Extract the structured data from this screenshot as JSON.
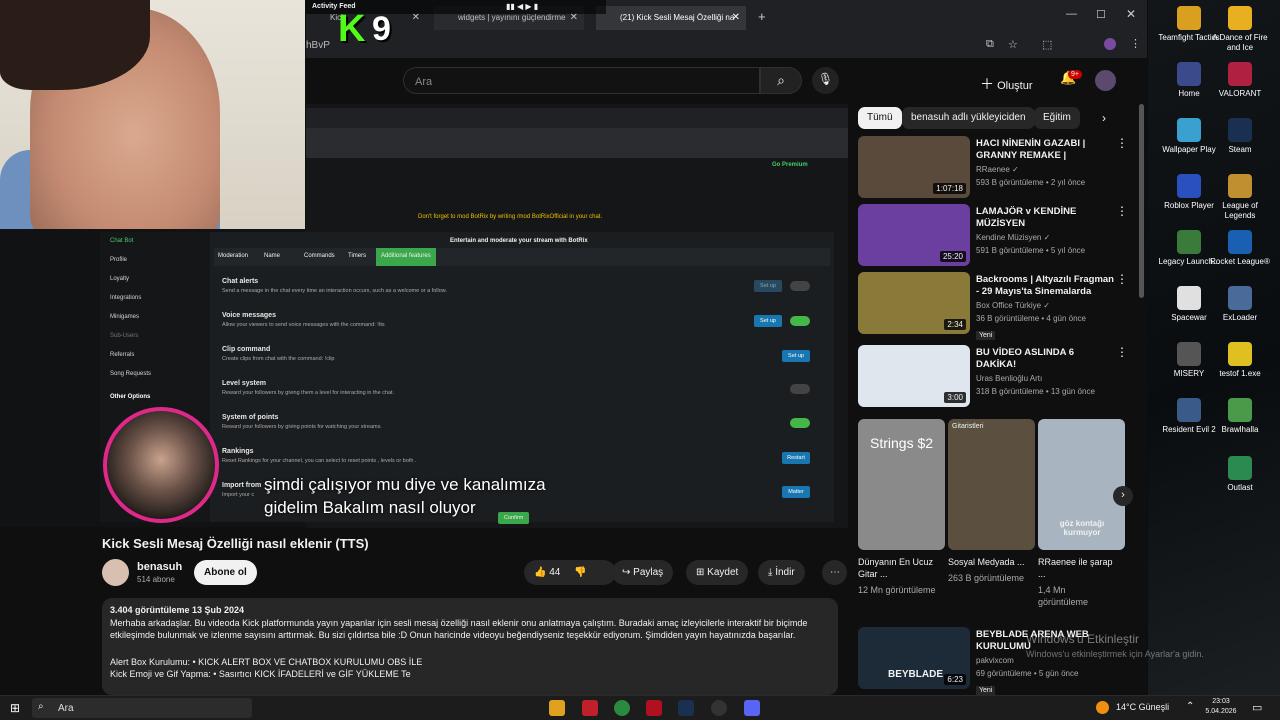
{
  "webcam_overlay": {
    "activity_label": "Activity Feed",
    "k_number": "9"
  },
  "browser": {
    "tabs": [
      {
        "label": "Kick"
      },
      {
        "label": "widgets | yayınını güçlendirme"
      },
      {
        "label": "(21) Kick Sesli Mesaj Özelliği na"
      }
    ],
    "address_fragment": "hBvP"
  },
  "youtube": {
    "search_placeholder": "Ara",
    "create_label": "Oluştur",
    "notif_count": "9+",
    "chips": [
      "Tümü",
      "benasuh adlı yükleyiciden",
      "Eğitim"
    ],
    "video_title": "Kick Sesli Mesaj Özelliği nasıl eklenir (TTS)",
    "channel": {
      "name": "benasuh",
      "subs": "514 abone",
      "subscribe": "Abone ol"
    },
    "actions": {
      "likes": "44",
      "share": "Paylaş",
      "save": "Kaydet",
      "download": "İndir"
    },
    "description": {
      "stats": "3.404 görüntüleme  13 Şub 2024",
      "body": "Merhaba arkadaşlar. Bu videoda Kick platformunda yayın yapanlar için sesli mesaj özelliği nasıl eklenir onu anlatmaya çalıştım. Buradaki amaç izleyicilerle interaktif bir biçimde etkileşimde bulunmak ve izlenme sayısını arttırmak. Bu sizi çıldırtsa bile :D Onun haricinde videoyu beğendiyseniz teşekkür ediyorum. Şimdiden yayın hayatınızda başarılar.",
      "line1": "Alert Box Kurulumu:  • KICK ALERT BOX VE CHATBOX KURULUMU OBS İLE",
      "line2": "Kick Emoji ve Gif Yapma:  • Sasırtıcı KICK İFADELERİ ve GİF YÜKLEME Te"
    },
    "caption": [
      "şimdi çalışıyor mu diye ve kanalımıza",
      "gidelim Bakalım nasıl oluyor"
    ],
    "recommended": [
      {
        "title": "HACI NİNENİN GAZABI | GRANNY REMAKE |",
        "channel": "RRaenee ✓",
        "stats": "593 B görüntüleme • 2 yıl önce",
        "duration": "1:07:18",
        "color": "#5a4a3c"
      },
      {
        "title": "LAMAJÖR v KENDİNE MÜZİSYEN",
        "channel": "Kendine Müzisyen ✓",
        "stats": "591 B görüntüleme • 5 yıl önce",
        "duration": "25:20",
        "color": "#6b3fa0"
      },
      {
        "title": "Backrooms | Altyazılı Fragman - 29 Mayıs'ta Sinemalarda",
        "channel": "Box Office Türkiye ✓",
        "stats": "36 B görüntüleme • 4 gün önce",
        "badge": "Yeni",
        "duration": "2:34",
        "color": "#8a7a3a"
      },
      {
        "title": "BU VİDEO ASLINDA 6 DAKİKA!",
        "channel": "Uras Benlioğlu Artı",
        "stats": "318 B görüntüleme • 13 gün önce",
        "duration": "3:00",
        "color": "#dfe6ee"
      }
    ],
    "shorts": [
      {
        "title": "Dünyanın En Ucuz Gitar ...",
        "views": "12 Mn görüntüleme",
        "label": "Strings $2"
      },
      {
        "title": "Sosyal Medyada ...",
        "views": "263 B görüntüleme",
        "label": "Gitaristleri"
      },
      {
        "title": "RRaenee ile şarap ...",
        "views": "1,4 Mn görüntüleme",
        "label": "göz kontağı kurmuyor"
      }
    ],
    "bottom_video": {
      "title": "BEYBLADE ARENA WEB KURULUMU",
      "channel": "pakvixcom",
      "stats": "69 görüntüleme • 5 gün önce",
      "badge": "Yeni",
      "duration": "6:23",
      "thumb_label": "BEYBLADE"
    }
  },
  "botrix": {
    "banner": "Don't forget to mod BotRix by writing /mod BotRixOfficial in your chat.",
    "go_premium": "Go Premium",
    "header": "Entertain and moderate your stream with BotRix",
    "tabs": [
      "Moderation",
      "Name",
      "Commands",
      "Timers",
      "Additional features"
    ],
    "sidebar": [
      "Chat Bot",
      "Profile",
      "Loyalty",
      "Integrations",
      "Minigames",
      "Sub-Users",
      "Referrals",
      "Song Requests",
      "Other Options"
    ],
    "features": [
      {
        "title": "Chat alerts",
        "desc": "Send a message in the chat every time an interaction occurs, such as a welcome or a follow.",
        "button": "Set up"
      },
      {
        "title": "Voice messages",
        "desc": "Allow your viewers to send voice messages with the command: !tts",
        "button": "Set up"
      },
      {
        "title": "Clip command",
        "desc": "Create clips from chat with the command: !clip",
        "button": "Set up"
      },
      {
        "title": "Level system",
        "desc": "Reward your followers by giving them a level for interacting in the chat.",
        "button": ""
      },
      {
        "title": "System of points",
        "desc": "Reward your followers by giving points for watching your streams.",
        "button": ""
      },
      {
        "title": "Rankings",
        "desc": "Reset Rankings for your channel, you can select to reset points , levels or both .",
        "button": "Restart"
      },
      {
        "title": "Import from",
        "desc": "Import your c",
        "button": "Matter"
      }
    ],
    "confirm": "Confirm"
  },
  "desktop_icons": [
    "Teamfight Tactics",
    "A Dance of Fire and Ice",
    "Home",
    "VALORANT",
    "Wallpaper Play",
    "Steam",
    "Roblox Player",
    "League of Legends",
    "Legacy Launch...",
    "Rocket League®",
    "Spacewar",
    "ExLoader",
    "MISERY",
    "testof 1.exe",
    "Resident Evil 2",
    "Brawlhalla",
    "Outlast"
  ],
  "watermark": {
    "line1": "Windows'u Etkinleştir",
    "line2": "Windows'u etkinleştirmek için Ayarlar'a gidin."
  },
  "taskbar": {
    "search": "Ara",
    "weather": "14°C  Güneşli",
    "time": "23:03",
    "date": "5.04.2026"
  }
}
